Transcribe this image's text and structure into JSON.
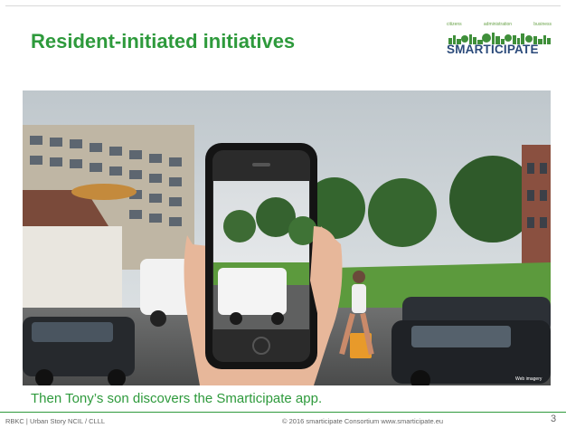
{
  "slide": {
    "title": "Resident-initiated initiatives",
    "caption": "Then Tony’s son discovers the Smarticipate app.",
    "footer_left": "RBKC | Urban Story NCIL / CLLL",
    "footer_center": "© 2016  smarticipate Consortium   www.smarticipate.eu",
    "page_number": "3"
  },
  "logo": {
    "tags": [
      "citizens",
      "administration",
      "business"
    ],
    "text": "SMARTICIPATE"
  },
  "photo": {
    "watermark": "Web imagery"
  },
  "colors": {
    "accent": "#2e9a3c",
    "logo_blue": "#2b4a7a"
  }
}
